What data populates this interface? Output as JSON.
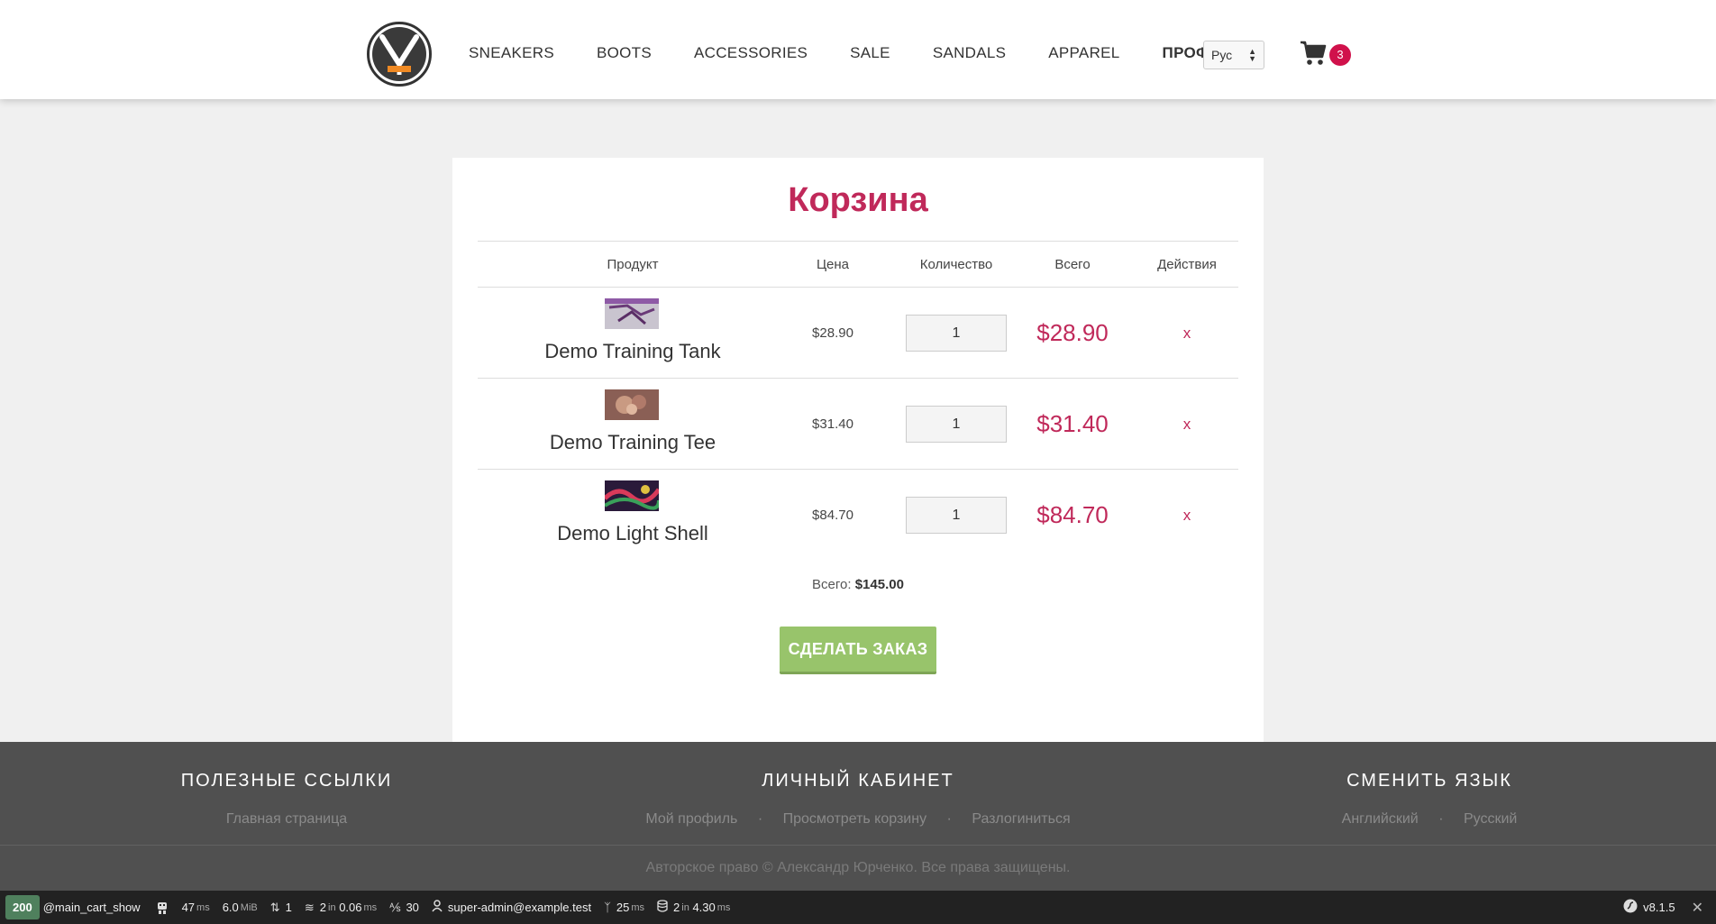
{
  "header": {
    "nav": [
      "SNEAKERS",
      "BOOTS",
      "ACCESSORIES",
      "SALE",
      "SANDALS",
      "APPAREL"
    ],
    "profile": "ПРОФИЛЬ",
    "lang_select": "Рус",
    "cart_count": "3"
  },
  "cart": {
    "title": "Корзина",
    "columns": {
      "product": "Продукт",
      "price": "Цена",
      "quantity": "Количество",
      "total": "Всего",
      "actions": "Действия"
    },
    "items": [
      {
        "name": "Demo Training Tank",
        "price": "$28.90",
        "qty": "1",
        "total": "$28.90",
        "remove": "x"
      },
      {
        "name": "Demo Training Tee",
        "price": "$31.40",
        "qty": "1",
        "total": "$31.40",
        "remove": "x"
      },
      {
        "name": "Demo Light Shell",
        "price": "$84.70",
        "qty": "1",
        "total": "$84.70",
        "remove": "x"
      }
    ],
    "sum_label": "Всего:",
    "sum_value": "$145.00",
    "order_button": "СДЕЛАТЬ ЗАКАЗ"
  },
  "footer": {
    "useful_links": {
      "title": "ПОЛЕЗНЫЕ ССЫЛКИ",
      "home": "Главная страница"
    },
    "account": {
      "title": "ЛИЧНЫЙ КАБИНЕТ",
      "profile": "Мой профиль",
      "view_cart": "Просмотреть корзину",
      "logout": "Разлогиниться"
    },
    "language": {
      "title": "СМЕНИТЬ ЯЗЫК",
      "english": "Английский",
      "russian": "Русский"
    },
    "copyright": "Авторское право © Александр Юрченко. Все права защищены."
  },
  "toolbar": {
    "status": "200",
    "route": "@main_cart_show",
    "time_val": "47",
    "time_unit": "ms",
    "memory_val": "6.0",
    "memory_unit": "MiB",
    "requests": "1",
    "cache_count": "2",
    "cache_in": "in",
    "cache_time": "0.06",
    "cache_unit": "ms",
    "translations": "30",
    "user": "super-admin@example.test",
    "twig_val": "25",
    "twig_unit": "ms",
    "db_count": "2",
    "db_in": "in",
    "db_time": "4.30",
    "db_unit": "ms",
    "version": "v8.1.5"
  }
}
